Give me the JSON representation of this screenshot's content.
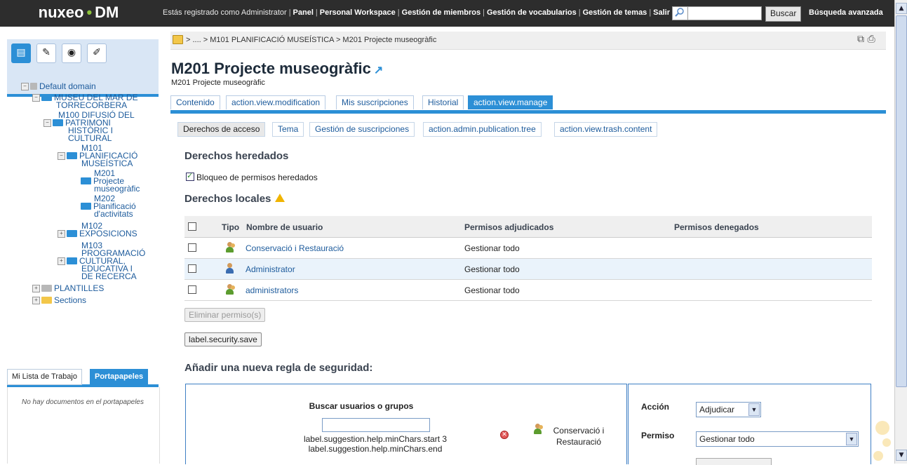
{
  "topbar": {
    "logo_left": "nuxeo",
    "logo_dot": "•",
    "logo_right": "DM",
    "registered": "Estás registrado como Administrator",
    "links": [
      "Panel",
      "Personal Workspace",
      "Gestión de miembros",
      "Gestión de vocabularios",
      "Gestión de temas",
      "Salir"
    ],
    "search_button": "Buscar",
    "advanced_search": "Búsqueda avanzada"
  },
  "sidebar": {
    "tree": [
      {
        "label": "Default domain"
      },
      {
        "label": "MUSEU DEL MAR DE"
      },
      {
        "label": "TORRECORBERA"
      },
      {
        "label": "M100 DIFUSIÓ DEL"
      },
      {
        "label": "PATRIMONI"
      },
      {
        "label": "HISTÒRIC I"
      },
      {
        "label": "CULTURAL"
      },
      {
        "label": "M101"
      },
      {
        "label": "PLANIFICACIÓ"
      },
      {
        "label": "MUSEÍSTICA"
      },
      {
        "label": "M201"
      },
      {
        "label": "Projecte"
      },
      {
        "label": "museogràfic"
      },
      {
        "label": "M202"
      },
      {
        "label": "Planificació"
      },
      {
        "label": "d'activitats"
      },
      {
        "label": "M102"
      },
      {
        "label": "EXPOSICIONS"
      },
      {
        "label": "M103"
      },
      {
        "label": "PROGRAMACIÓ"
      },
      {
        "label": "CULTURAL,"
      },
      {
        "label": "EDUCATIVA I"
      },
      {
        "label": "DE RECERCA"
      },
      {
        "label": "PLANTILLES"
      },
      {
        "label": "Sections"
      }
    ],
    "ws_tabs": [
      "Mi Lista de Trabajo",
      "Portapapeles"
    ],
    "clipboard_empty": "No hay documentos en el portapapeles"
  },
  "breadcrumb": "> .... > M101 PLANIFICACIÓ MUSEÍSTICA > M201 Projecte museogràfic",
  "page": {
    "title": "M201 Projecte museogràfic",
    "subtitle": "M201 Projecte museogràfic"
  },
  "main_tabs": [
    "Contenido",
    "action.view.modification",
    "Mis suscripciones",
    "Historial",
    "action.view.manage"
  ],
  "sub_tabs": [
    "Derechos de acceso",
    "Tema",
    "Gestión de suscripciones",
    "action.admin.publication.tree",
    "action.view.trash.content"
  ],
  "inherited": {
    "heading": "Derechos heredados",
    "block_label": "Bloqueo de permisos heredados"
  },
  "local": {
    "heading": "Derechos locales",
    "columns": [
      "Tipo",
      "Nombre de usuario",
      "Permisos adjudicados",
      "Permisos denegados"
    ],
    "rows": [
      {
        "name": "Conservació i Restauració",
        "granted": "Gestionar todo",
        "denied": "",
        "type": "group"
      },
      {
        "name": "Administrator",
        "granted": "Gestionar todo",
        "denied": "",
        "type": "user"
      },
      {
        "name": "administrators",
        "granted": "Gestionar todo",
        "denied": "",
        "type": "group"
      }
    ],
    "remove_button": "Eliminar permiso(s)",
    "save_button": "label.security.save"
  },
  "new_rule": {
    "heading": "Añadir una nueva regla de seguridad:",
    "search_title": "Buscar usuarios o grupos",
    "hint_start": "label.suggestion.help.minChars.start 3",
    "hint_end": "label.suggestion.help.minChars.end",
    "selected_line1": "Conservació i",
    "selected_line2": "Restauració",
    "action_label": "Acción",
    "action_value": "Adjudicar",
    "permission_label": "Permiso",
    "permission_value": "Gestionar todo"
  },
  "colors": {
    "accent": "#2c8fd6",
    "topbar": "#2d2d2d",
    "brand_dot": "#8ec43c"
  }
}
